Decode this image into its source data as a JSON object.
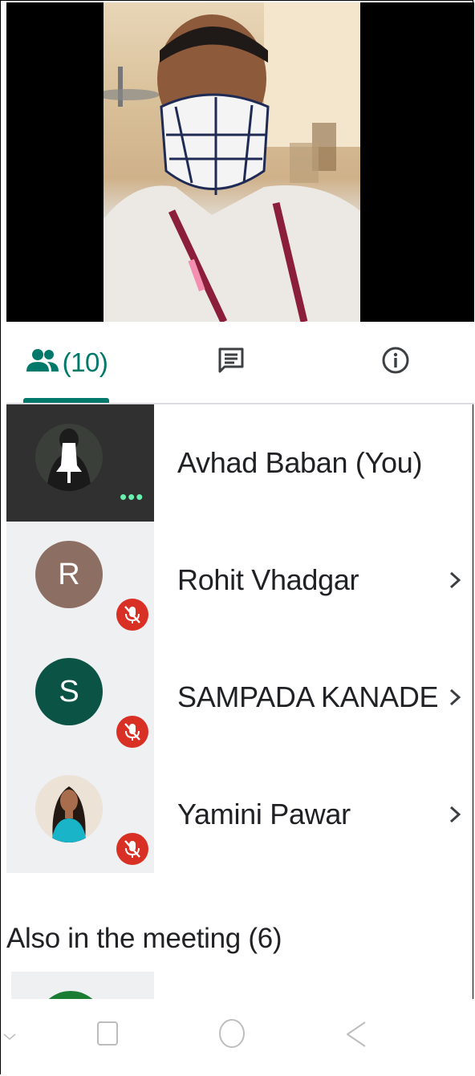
{
  "video": {
    "speaker_tile": "camera-feed"
  },
  "tabs": {
    "people_count": "(10)",
    "chat_icon": "chat-icon",
    "info_icon": "info-icon",
    "active": "people",
    "accent_color": "#00796b"
  },
  "participants": [
    {
      "name": "Avhad Baban (You)",
      "avatar": "photo",
      "status": "speaking",
      "self": true
    },
    {
      "name": "Rohit Vhadgar",
      "avatar_letter": "R",
      "avatar_color": "#8d6e63",
      "muted": true
    },
    {
      "name": "SAMPADA KANADE",
      "avatar_letter": "S",
      "avatar_color": "#0b5345",
      "muted": true
    },
    {
      "name": "Yamini Pawar",
      "avatar": "photo",
      "muted": true
    }
  ],
  "also_in_meeting": {
    "heading": "Also in the meeting (6)"
  },
  "colors": {
    "mute_badge": "#d93025",
    "speaking_dots": "#69f0ae"
  },
  "nav": {
    "buttons": [
      "collapse-icon",
      "recents-icon",
      "home-icon",
      "back-icon"
    ]
  }
}
